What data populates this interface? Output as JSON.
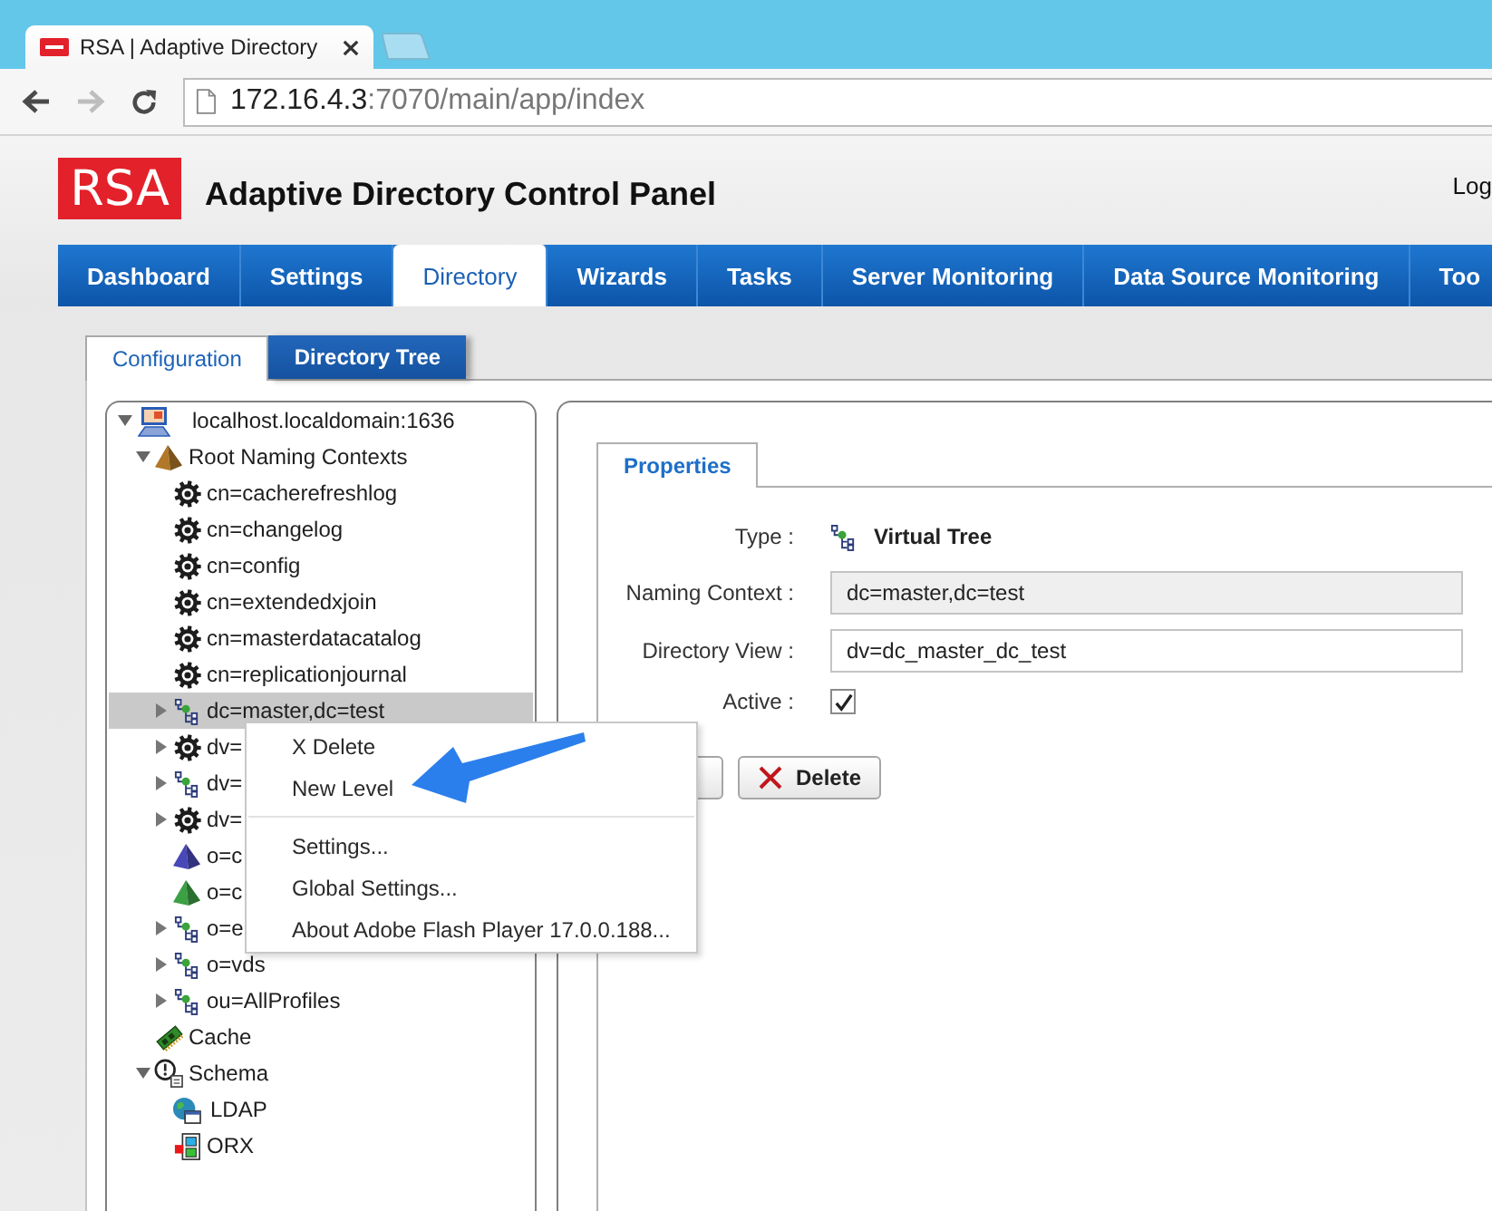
{
  "browser": {
    "tab": {
      "title": "RSA | Adaptive Directory"
    },
    "address": {
      "host": "172.16.4.3",
      "path": ":7070/main/app/index"
    }
  },
  "header": {
    "logo": "RSA",
    "title": "Adaptive Directory Control Panel",
    "link": "Log"
  },
  "nav": [
    {
      "label": "Dashboard",
      "selected": false
    },
    {
      "label": "Settings",
      "selected": false
    },
    {
      "label": "Directory",
      "selected": true
    },
    {
      "label": "Wizards",
      "selected": false
    },
    {
      "label": "Tasks",
      "selected": false
    },
    {
      "label": "Server Monitoring",
      "selected": false
    },
    {
      "label": "Data Source Monitoring",
      "selected": false
    },
    {
      "label": "Too",
      "selected": false
    }
  ],
  "subtabs": [
    {
      "label": "Configuration",
      "selected": true
    },
    {
      "label": "Directory Tree",
      "selected": false
    }
  ],
  "tree": [
    {
      "label": "localhost.localdomain:1636",
      "kind": "server",
      "expandable": true,
      "expanded": true,
      "selected": false,
      "children": [
        {
          "label": "Root Naming Contexts",
          "kind": "pyramid",
          "color": "#b07828",
          "expandable": true,
          "expanded": true,
          "selected": false,
          "children": [
            {
              "label": "cn=cacherefreshlog",
              "kind": "gear",
              "expandable": false,
              "selected": false
            },
            {
              "label": "cn=changelog",
              "kind": "gear",
              "expandable": false,
              "selected": false
            },
            {
              "label": "cn=config",
              "kind": "gear",
              "expandable": false,
              "selected": false
            },
            {
              "label": "cn=extendedxjoin",
              "kind": "gear",
              "expandable": false,
              "selected": false
            },
            {
              "label": "cn=masterdatacatalog",
              "kind": "gear",
              "expandable": false,
              "selected": false
            },
            {
              "label": "cn=replicationjournal",
              "kind": "gear",
              "expandable": false,
              "selected": false
            },
            {
              "label": "dc=master,dc=test",
              "kind": "virtual-tree",
              "expandable": true,
              "expanded": false,
              "selected": true
            },
            {
              "label": "dv=",
              "kind": "gear",
              "expandable": true,
              "expanded": false,
              "selected": false
            },
            {
              "label": "dv=",
              "kind": "virtual-tree",
              "expandable": true,
              "expanded": false,
              "selected": false
            },
            {
              "label": "dv=",
              "kind": "gear",
              "expandable": true,
              "expanded": false,
              "selected": false
            },
            {
              "label": "o=c",
              "kind": "pyramid",
              "color": "#4848b8",
              "expandable": false,
              "selected": false
            },
            {
              "label": "o=c",
              "kind": "pyramid",
              "color": "#3ca044",
              "expandable": false,
              "selected": false
            },
            {
              "label": "o=e",
              "kind": "virtual-tree",
              "expandable": true,
              "expanded": false,
              "selected": false
            },
            {
              "label": "o=vds",
              "kind": "virtual-tree",
              "expandable": true,
              "expanded": false,
              "selected": false
            },
            {
              "label": "ou=AllProfiles",
              "kind": "virtual-tree",
              "expandable": true,
              "expanded": false,
              "selected": false
            }
          ]
        },
        {
          "label": "Cache",
          "kind": "cache",
          "expandable": false,
          "selected": false
        },
        {
          "label": "Schema",
          "kind": "schema",
          "expandable": true,
          "expanded": true,
          "selected": false,
          "children": [
            {
              "label": "LDAP",
              "kind": "ldap",
              "expandable": false,
              "selected": false
            },
            {
              "label": "ORX",
              "kind": "orx",
              "expandable": false,
              "selected": false
            }
          ]
        }
      ]
    }
  ],
  "context_menu": {
    "groups": [
      [
        {
          "label": "X Delete"
        },
        {
          "label": "New Level"
        }
      ],
      [
        {
          "label": "Settings..."
        },
        {
          "label": "Global Settings..."
        },
        {
          "label": "About Adobe Flash Player 17.0.0.188..."
        }
      ]
    ]
  },
  "properties": {
    "tabs": [
      {
        "label": "Properties",
        "selected": true
      }
    ],
    "fields": [
      {
        "kind": "type",
        "label": "Type :",
        "value": "Virtual Tree"
      },
      {
        "kind": "readonly",
        "label": "Naming Context :",
        "value": "dc=master,dc=test"
      },
      {
        "kind": "input",
        "label": "Directory View :",
        "value": "dv=dc_master_dc_test"
      },
      {
        "kind": "checkbox",
        "label": "Active :",
        "checked": true
      }
    ],
    "buttons": [
      {
        "kind": "covered"
      },
      {
        "kind": "delete",
        "label": "Delete"
      }
    ]
  }
}
